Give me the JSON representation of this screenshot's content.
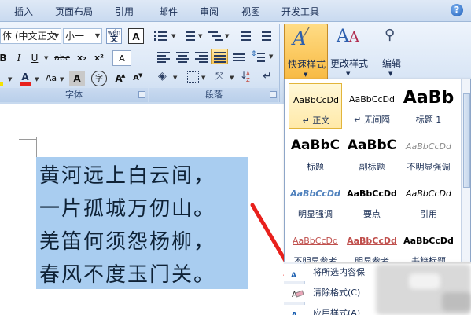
{
  "tabs": [
    "插入",
    "页面布局",
    "引用",
    "邮件",
    "审阅",
    "视图",
    "开发工具"
  ],
  "help_icon": "?",
  "font_group": {
    "caption": "字体",
    "font_name": "体 (中文正文",
    "font_size": "小一",
    "phonetic_icon": "wén",
    "char_border_icon": "A",
    "bold": "B",
    "italic": "I",
    "underline": "U",
    "strike": "abc",
    "subscript": "x₂",
    "superscript": "x²",
    "clear_format_icon": "A",
    "font_color_icon": "A",
    "change_case": "Aa",
    "char_shading": "A",
    "enclose_char": "字",
    "grow_font": "A",
    "shrink_font": "A",
    "accent_colors": {
      "highlight": "#f4e200",
      "font_color": "#e8201c"
    }
  },
  "paragraph_group": {
    "caption": "段落"
  },
  "styles_group": {
    "quick_styles_label": "快速样式",
    "change_styles_label": "更改样式"
  },
  "edit_group": {
    "label": "编辑"
  },
  "document": {
    "poem_lines": [
      "黄河远上白云间，",
      "一片孤城万仞山。",
      "羌笛何须怨杨柳，",
      "春风不度玉门关。"
    ],
    "selection_color": "#a9cdf0"
  },
  "gallery": {
    "styles": [
      {
        "sample": "AaBbCcDd",
        "name": "↵ 正文"
      },
      {
        "sample": "AaBbCcDd",
        "name": "↵ 无间隔"
      },
      {
        "sample": "AaBb",
        "name": "标题 1"
      },
      {
        "sample": "AaBbC",
        "name": "标题"
      },
      {
        "sample": "AaBbC",
        "name": "副标题"
      },
      {
        "sample": "AaBbCcDd",
        "name": "不明显强调"
      },
      {
        "sample": "AaBbCcDd",
        "name": "明显强调"
      },
      {
        "sample": "AaBbCcDd",
        "name": "要点"
      },
      {
        "sample": "AaBbCcDd",
        "name": "引用"
      },
      {
        "sample": "AaBbCcDd",
        "name": "不明显参考"
      },
      {
        "sample": "AaBbCcDd",
        "name": "明显参考"
      },
      {
        "sample": "AaBbCcDd",
        "name": "书籍标题"
      }
    ],
    "commands": [
      "将所选内容保",
      "清除格式(C)",
      "应用样式(A)"
    ]
  }
}
